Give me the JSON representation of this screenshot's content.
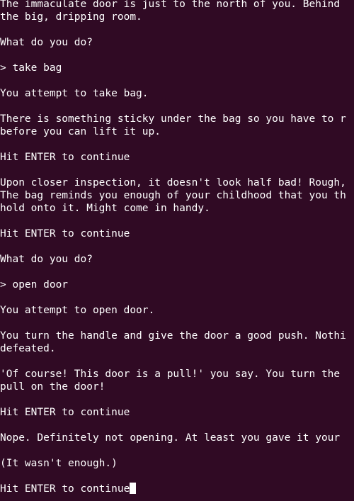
{
  "terminal": {
    "lines": [
      "The immaculate door is just to the north of you. Behind",
      "the big, dripping room.",
      "",
      "What do you do?",
      "",
      "> take bag",
      "",
      "You attempt to take bag.",
      "",
      "There is something sticky under the bag so you have to r",
      "before you can lift it up.",
      "",
      "Hit ENTER to continue",
      "",
      "Upon closer inspection, it doesn't look half bad! Rough,",
      "The bag reminds you enough of your childhood that you th",
      "hold onto it. Might come in handy.",
      "",
      "Hit ENTER to continue",
      "",
      "What do you do?",
      "",
      "> open door",
      "",
      "You attempt to open door.",
      "",
      "You turn the handle and give the door a good push. Nothi",
      "defeated.",
      "",
      "'Of course! This door is a pull!' you say. You turn the",
      "pull on the door!",
      "",
      "Hit ENTER to continue",
      "",
      "Nope. Definitely not opening. At least you gave it your",
      "",
      "(It wasn't enough.)",
      "",
      "Hit ENTER to continue"
    ],
    "background_color": "#300a24",
    "text_color": "#ffffff"
  }
}
